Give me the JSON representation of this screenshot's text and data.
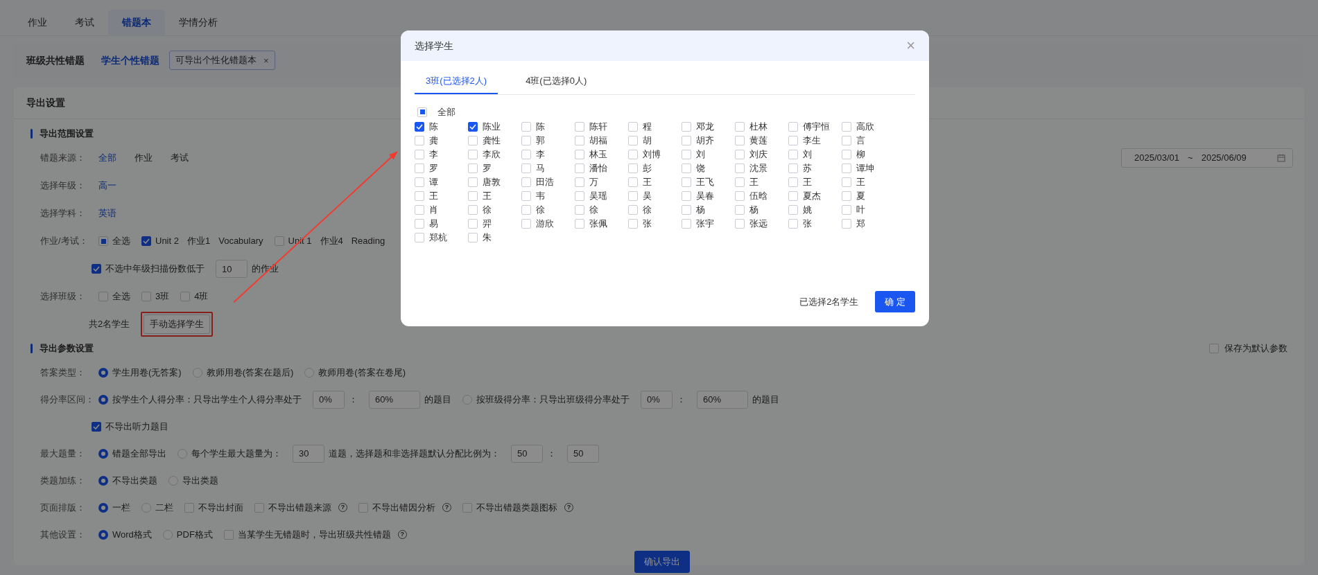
{
  "top_tabs": [
    {
      "label": "作业",
      "selected": false
    },
    {
      "label": "考试",
      "selected": false
    },
    {
      "label": "错题本",
      "selected": true
    },
    {
      "label": "学情分析",
      "selected": false
    }
  ],
  "mode_tabs": [
    {
      "label": "班级共性错题",
      "selected": false
    },
    {
      "label": "学生个性错题",
      "selected": true
    }
  ],
  "mode_tag": {
    "label": "可导出个性化错题本",
    "close": "×"
  },
  "export_settings": {
    "title": "导出设置",
    "scope": {
      "title": "导出范围设置",
      "rows": [
        {
          "label": "错题来源：",
          "parts": [
            {
              "kind": "option",
              "label": "全部",
              "selected": true
            },
            {
              "kind": "option",
              "label": "作业",
              "selected": false
            },
            {
              "kind": "option",
              "label": "考试",
              "selected": false
            }
          ],
          "date_range": {
            "start": "2025/03/01",
            "separator": "~",
            "end": "2025/06/09"
          }
        },
        {
          "label": "选择年级：",
          "parts": [
            {
              "kind": "option",
              "label": "高一",
              "selected": true
            }
          ]
        },
        {
          "label": "选择学科：",
          "parts": [
            {
              "kind": "option",
              "label": "英语",
              "selected": true
            }
          ]
        },
        {
          "label": "作业/考试：",
          "parts": [
            {
              "kind": "check_all",
              "label": "全选",
              "indeterminate": true
            },
            {
              "kind": "check",
              "label": "Unit 2",
              "checked": true
            },
            {
              "kind": "text",
              "text": "作业1"
            },
            {
              "kind": "text",
              "text": "Vocabulary"
            },
            {
              "kind": "check",
              "label": "Unit 1",
              "checked": false
            },
            {
              "kind": "text",
              "text": "作业4"
            },
            {
              "kind": "text",
              "text": "Reading"
            }
          ]
        },
        {
          "parts": [
            {
              "kind": "check",
              "label": "不选中年级扫描份数低于",
              "checked": true
            },
            {
              "kind": "input",
              "value": "10"
            },
            {
              "kind": "text",
              "text": "的作业"
            }
          ]
        },
        {
          "label": "选择班级：",
          "parts": [
            {
              "kind": "check",
              "label": "全选",
              "checked": false
            },
            {
              "kind": "check",
              "label": "3班",
              "checked": false
            },
            {
              "kind": "check",
              "label": "4班",
              "checked": false
            }
          ]
        },
        {
          "parts": [
            {
              "kind": "text",
              "text": "共2名学生"
            },
            {
              "kind": "button",
              "label": "手动选择学生",
              "highlighted": true
            }
          ]
        }
      ]
    },
    "params": {
      "title": "导出参数设置",
      "save_default": {
        "label": "保存为默认参数",
        "checked": false
      },
      "rows": [
        {
          "label": "答案类型：",
          "parts": [
            {
              "kind": "radio",
              "label": "学生用卷(无答案)",
              "selected": true
            },
            {
              "kind": "radio",
              "label": "教师用卷(答案在题后)",
              "selected": false
            },
            {
              "kind": "radio",
              "label": "教师用卷(答案在卷尾)",
              "selected": false
            }
          ]
        },
        {
          "label": "得分率区间：",
          "parts": [
            {
              "kind": "radio",
              "label": "按学生个人得分率：只导出学生个人得分率处于",
              "selected": true
            },
            {
              "kind": "input",
              "value": "0%"
            },
            {
              "kind": "text",
              "text": "："
            },
            {
              "kind": "input",
              "value": "60%"
            },
            {
              "kind": "text",
              "text": "的题目"
            },
            {
              "kind": "radio",
              "label": "按班级得分率：只导出班级得分率处于",
              "selected": false
            },
            {
              "kind": "input",
              "value": "0%"
            },
            {
              "kind": "text",
              "text": "："
            },
            {
              "kind": "input",
              "value": "60%"
            },
            {
              "kind": "text",
              "text": "的题目"
            }
          ]
        },
        {
          "parts": [
            {
              "kind": "check",
              "label": "不导出听力题目",
              "checked": true
            }
          ]
        },
        {
          "label": "最大题量：",
          "parts": [
            {
              "kind": "radio",
              "label": "错题全部导出",
              "selected": true
            },
            {
              "kind": "radio",
              "label": "每个学生最大题量为：",
              "selected": false
            },
            {
              "kind": "input",
              "value": "30"
            },
            {
              "kind": "text",
              "text": "道题，选择题和非选择题默认分配比例为："
            },
            {
              "kind": "input",
              "value": "50"
            },
            {
              "kind": "text",
              "text": "："
            },
            {
              "kind": "input",
              "value": "50"
            }
          ]
        },
        {
          "label": "类题加练：",
          "parts": [
            {
              "kind": "radio",
              "label": "不导出类题",
              "selected": true
            },
            {
              "kind": "radio",
              "label": "导出类题",
              "selected": false
            }
          ]
        },
        {
          "label": "页面排版：",
          "parts": [
            {
              "kind": "radio",
              "label": "一栏",
              "selected": true
            },
            {
              "kind": "radio",
              "label": "二栏",
              "selected": false
            },
            {
              "kind": "check",
              "label": "不导出封面",
              "checked": false
            },
            {
              "kind": "check",
              "label": "不导出错题来源",
              "checked": false
            },
            {
              "kind": "help",
              "glyph": "?"
            },
            {
              "kind": "check",
              "label": "不导出错因分析",
              "checked": false
            },
            {
              "kind": "help",
              "glyph": "?"
            },
            {
              "kind": "check",
              "label": "不导出错题类题图标",
              "checked": false
            },
            {
              "kind": "help",
              "glyph": "?"
            }
          ]
        },
        {
          "label": "其他设置：",
          "parts": [
            {
              "kind": "radio",
              "label": "Word格式",
              "selected": true
            },
            {
              "kind": "radio",
              "label": "PDF格式",
              "selected": false
            },
            {
              "kind": "check",
              "label": "当某学生无错题时，导出班级共性错题",
              "checked": false
            },
            {
              "kind": "help",
              "glyph": "?"
            }
          ]
        }
      ]
    },
    "confirm_button": "确认导出"
  },
  "modal": {
    "title": "选择学生",
    "close": "×",
    "tabs": [
      {
        "label": "3班(已选择2人)",
        "selected": true
      },
      {
        "label": "4班(已选择0人)",
        "selected": false
      }
    ],
    "select_all": {
      "label": "全部",
      "indeterminate": true
    },
    "students": [
      {
        "name": "陈",
        "checked": true
      },
      {
        "name": "陈业",
        "checked": true
      },
      {
        "name": "陈",
        "checked": false
      },
      {
        "name": "陈轩",
        "checked": false
      },
      {
        "name": "程",
        "checked": false
      },
      {
        "name": "邓龙",
        "checked": false
      },
      {
        "name": "杜林",
        "checked": false
      },
      {
        "name": "傅宇恒",
        "checked": false
      },
      {
        "name": "高欣",
        "checked": false
      },
      {
        "name": "龚",
        "checked": false
      },
      {
        "name": "龚性",
        "checked": false
      },
      {
        "name": "郭",
        "checked": false
      },
      {
        "name": "胡福",
        "checked": false
      },
      {
        "name": "胡",
        "checked": false
      },
      {
        "name": "胡齐",
        "checked": false
      },
      {
        "name": "黄莲",
        "checked": false
      },
      {
        "name": "李生",
        "checked": false
      },
      {
        "name": "言",
        "checked": false
      },
      {
        "name": "李",
        "checked": false
      },
      {
        "name": "李欣",
        "checked": false
      },
      {
        "name": "李",
        "checked": false
      },
      {
        "name": "林玉",
        "checked": false
      },
      {
        "name": "刘博",
        "checked": false
      },
      {
        "name": "刘",
        "checked": false
      },
      {
        "name": "刘庆",
        "checked": false
      },
      {
        "name": "刘",
        "checked": false
      },
      {
        "name": "柳",
        "checked": false
      },
      {
        "name": "罗",
        "checked": false
      },
      {
        "name": "罗",
        "checked": false
      },
      {
        "name": "马",
        "checked": false
      },
      {
        "name": "潘怡",
        "checked": false
      },
      {
        "name": "彭",
        "checked": false
      },
      {
        "name": "饶",
        "checked": false
      },
      {
        "name": "沈景",
        "checked": false
      },
      {
        "name": "苏",
        "checked": false
      },
      {
        "name": "谭坤",
        "checked": false
      },
      {
        "name": "谭",
        "checked": false
      },
      {
        "name": "唐敦",
        "checked": false
      },
      {
        "name": "田浩",
        "checked": false
      },
      {
        "name": "万",
        "checked": false
      },
      {
        "name": "王",
        "checked": false
      },
      {
        "name": "王飞",
        "checked": false
      },
      {
        "name": "王",
        "checked": false
      },
      {
        "name": "王",
        "checked": false
      },
      {
        "name": "王",
        "checked": false
      },
      {
        "name": "王",
        "checked": false
      },
      {
        "name": "王",
        "checked": false
      },
      {
        "name": "韦",
        "checked": false
      },
      {
        "name": "吴瑶",
        "checked": false
      },
      {
        "name": "吴",
        "checked": false
      },
      {
        "name": "吴春",
        "checked": false
      },
      {
        "name": "伍晗",
        "checked": false
      },
      {
        "name": "夏杰",
        "checked": false
      },
      {
        "name": "夏",
        "checked": false
      },
      {
        "name": "肖",
        "checked": false
      },
      {
        "name": "徐",
        "checked": false
      },
      {
        "name": "徐",
        "checked": false
      },
      {
        "name": "徐",
        "checked": false
      },
      {
        "name": "徐",
        "checked": false
      },
      {
        "name": "杨",
        "checked": false
      },
      {
        "name": "杨",
        "checked": false
      },
      {
        "name": "姚",
        "checked": false
      },
      {
        "name": "叶",
        "checked": false
      },
      {
        "name": "易",
        "checked": false
      },
      {
        "name": "羿",
        "checked": false
      },
      {
        "name": "游欣",
        "checked": false
      },
      {
        "name": "张佩",
        "checked": false
      },
      {
        "name": "张",
        "checked": false
      },
      {
        "name": "张宇",
        "checked": false
      },
      {
        "name": "张远",
        "checked": false
      },
      {
        "name": "张",
        "checked": false
      },
      {
        "name": "郑",
        "checked": false
      },
      {
        "name": "郑杭",
        "checked": false
      },
      {
        "name": "朱",
        "checked": false
      }
    ],
    "summary": "已选择2名学生",
    "confirm": "确 定"
  }
}
